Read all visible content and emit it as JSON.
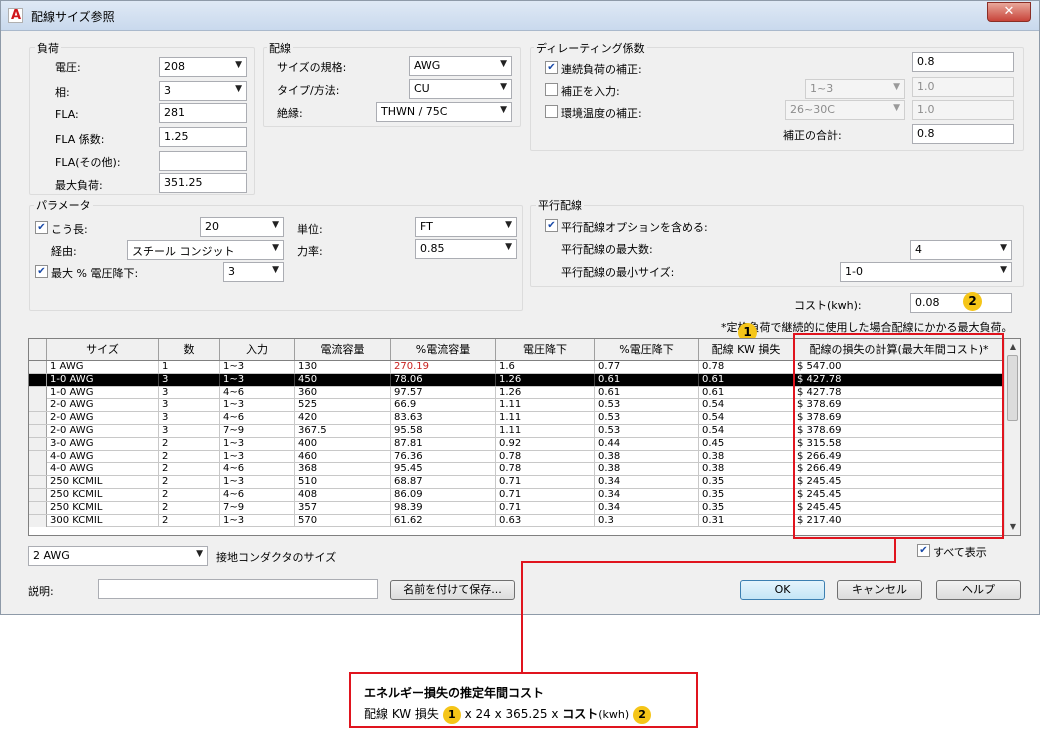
{
  "window": {
    "title": "配線サイズ参照",
    "app_icon_letter": "A"
  },
  "load": {
    "title": "負荷",
    "voltage_label": "電圧:",
    "voltage_value": "208",
    "phase_label": "相:",
    "phase_value": "3",
    "fla_label": "FLA:",
    "fla_value": "281",
    "fla_factor_label": "FLA 係数:",
    "fla_factor_value": "1.25",
    "fla_other_label": "FLA(その他):",
    "fla_other_value": "",
    "max_load_label": "最大負荷:",
    "max_load_value": "351.25"
  },
  "wiring": {
    "title": "配線",
    "size_std_label": "サイズの規格:",
    "size_std_value": "AWG",
    "type_label": "タイプ/方法:",
    "type_value": "CU",
    "insulation_label": "絶縁:",
    "insulation_value": "THWN / 75C"
  },
  "derating": {
    "title": "ディレーティング係数",
    "continuous_label": "連続負荷の補正:",
    "continuous_value": "0.8",
    "input_label": "補正を入力:",
    "input_combo": "1~3",
    "input_value": "1.0",
    "ambient_label": "環境温度の補正:",
    "ambient_combo": "26~30C",
    "ambient_value": "1.0",
    "total_label": "補正の合計:",
    "total_value": "0.8"
  },
  "params": {
    "title": "パラメータ",
    "length_label": "こう長:",
    "length_value": "20",
    "unit_label": "単位:",
    "unit_value": "FT",
    "route_label": "経由:",
    "route_value": "スチール コンジット",
    "pf_label": "力率:",
    "pf_value": "0.85",
    "max_drop_label": "最大 % 電圧降下:",
    "max_drop_value": "3"
  },
  "parallel": {
    "title": "平行配線",
    "include_label": "平行配線オプションを含める:",
    "max_count_label": "平行配線の最大数:",
    "max_count_value": "4",
    "min_size_label": "平行配線の最小サイズ:",
    "min_size_value": "1-0"
  },
  "cost": {
    "label": "コスト(kwh):",
    "value": "0.08",
    "note": "*定格負荷で継続的に使用した場合配線にかかる最大負荷。"
  },
  "table": {
    "headers": [
      "サイズ",
      "数",
      "入力",
      "電流容量",
      "%電流容量",
      "電圧降下",
      "%電圧降下",
      "配線 KW 損失",
      "配線の損失の計算(最大年間コスト)*"
    ],
    "rows": [
      [
        "1 AWG",
        "1",
        "1~3",
        "130",
        "270.19",
        "1.6",
        "0.77",
        "0.78",
        "$ 547.00"
      ],
      [
        "1-0 AWG",
        "3",
        "1~3",
        "450",
        "78.06",
        "1.26",
        "0.61",
        "0.61",
        "$ 427.78"
      ],
      [
        "1-0 AWG",
        "3",
        "4~6",
        "360",
        "97.57",
        "1.26",
        "0.61",
        "0.61",
        "$ 427.78"
      ],
      [
        "2-0 AWG",
        "3",
        "1~3",
        "525",
        "66.9",
        "1.11",
        "0.53",
        "0.54",
        "$ 378.69"
      ],
      [
        "2-0 AWG",
        "3",
        "4~6",
        "420",
        "83.63",
        "1.11",
        "0.53",
        "0.54",
        "$ 378.69"
      ],
      [
        "2-0 AWG",
        "3",
        "7~9",
        "367.5",
        "95.58",
        "1.11",
        "0.53",
        "0.54",
        "$ 378.69"
      ],
      [
        "3-0 AWG",
        "2",
        "1~3",
        "400",
        "87.81",
        "0.92",
        "0.44",
        "0.45",
        "$ 315.58"
      ],
      [
        "4-0 AWG",
        "2",
        "1~3",
        "460",
        "76.36",
        "0.78",
        "0.38",
        "0.38",
        "$ 266.49"
      ],
      [
        "4-0 AWG",
        "2",
        "4~6",
        "368",
        "95.45",
        "0.78",
        "0.38",
        "0.38",
        "$ 266.49"
      ],
      [
        "250 KCMIL",
        "2",
        "1~3",
        "510",
        "68.87",
        "0.71",
        "0.34",
        "0.35",
        "$ 245.45"
      ],
      [
        "250 KCMIL",
        "2",
        "4~6",
        "408",
        "86.09",
        "0.71",
        "0.34",
        "0.35",
        "$ 245.45"
      ],
      [
        "250 KCMIL",
        "2",
        "7~9",
        "357",
        "98.39",
        "0.71",
        "0.34",
        "0.35",
        "$ 245.45"
      ],
      [
        "300 KCMIL",
        "2",
        "1~3",
        "570",
        "61.62",
        "0.63",
        "0.3",
        "0.31",
        "$ 217.40"
      ]
    ],
    "selected_row": 1,
    "red_cell": {
      "row": 0,
      "col": 4
    }
  },
  "bottom": {
    "ground_size_value": "2 AWG",
    "ground_label": "接地コンダクタのサイズ",
    "show_all_label": "すべて表示",
    "desc_label": "説明:",
    "desc_value": "",
    "save_as_label": "名前を付けて保存...",
    "ok_label": "OK",
    "cancel_label": "キャンセル",
    "help_label": "ヘルプ"
  },
  "badges": {
    "one": "1",
    "two": "2"
  },
  "callout": {
    "title": "エネルギー損失の推定年間コスト",
    "formula_part1": "配線 KW 損失",
    "formula_part2": "x 24 x 365.25 x",
    "formula_part3": "コスト",
    "formula_part4": "(kwh)"
  },
  "colors": {
    "callout_red": "#e0141e",
    "badge_yellow": "#f5c518",
    "accent_blue": "#1a4aa8"
  }
}
